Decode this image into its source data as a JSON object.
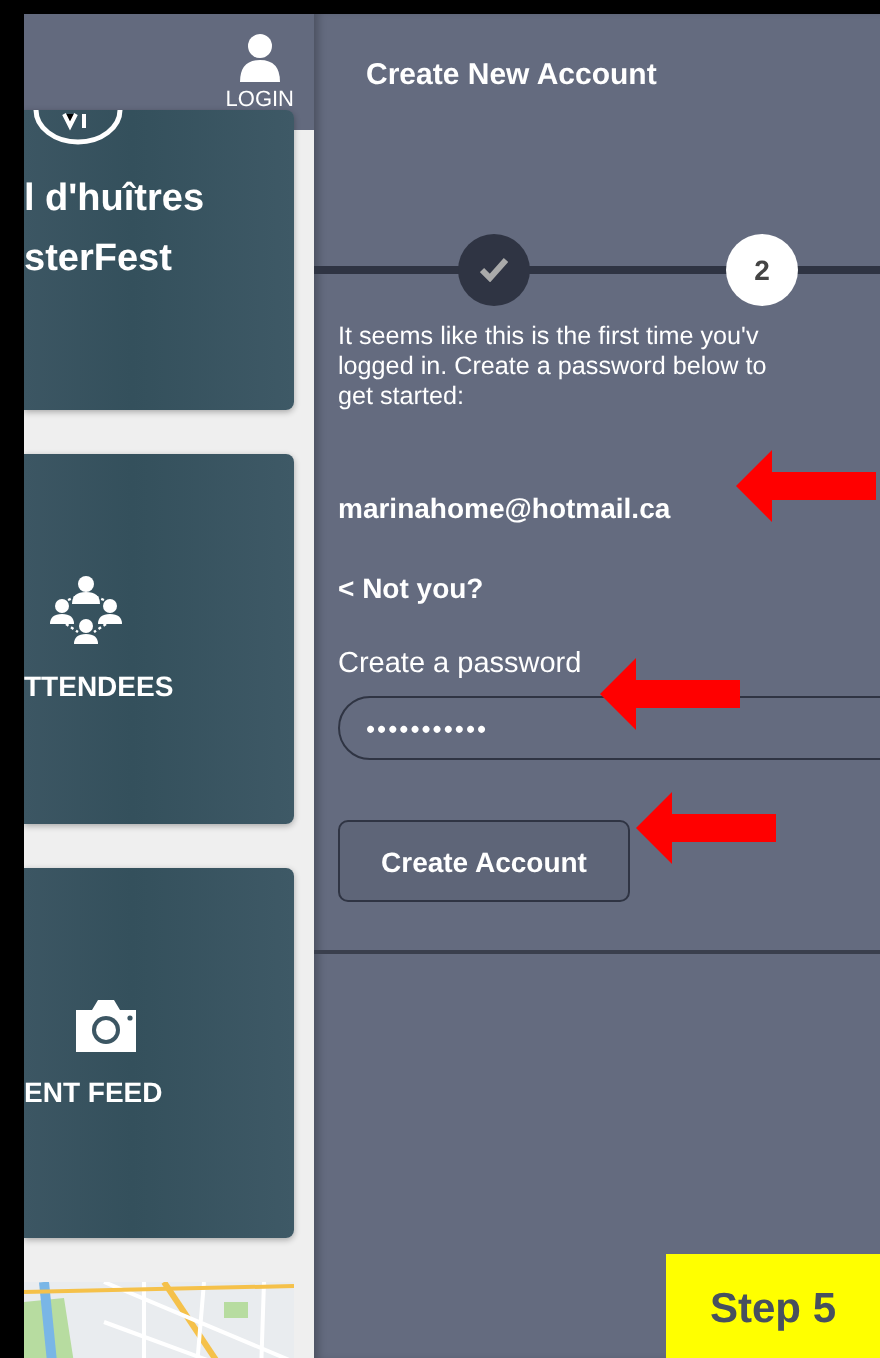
{
  "sidebar": {
    "login": {
      "label": "LOGIN"
    },
    "cards": [
      {
        "kind": "event",
        "lines": [
          "l d'huîtres",
          "sterFest"
        ]
      },
      {
        "kind": "attendees",
        "lines": [
          "TTENDEES"
        ]
      },
      {
        "kind": "feed",
        "lines": [
          "ENT FEED"
        ]
      },
      {
        "kind": "picture"
      }
    ]
  },
  "dialog": {
    "title": "Create New Account",
    "steps": [
      {
        "kind": "done",
        "done": true
      },
      {
        "kind": "number",
        "label": "2",
        "done": false
      }
    ],
    "message": [
      "It seems like this is the first time you'v",
      "logged in. Create a password below to",
      "get started:"
    ],
    "email": "marinahome@hotmail.ca",
    "not_you": "< Not you?",
    "password": {
      "label": "Create a password",
      "value": "•••••••••••"
    },
    "button": "Create Account"
  },
  "step_badge": "Step 5"
}
